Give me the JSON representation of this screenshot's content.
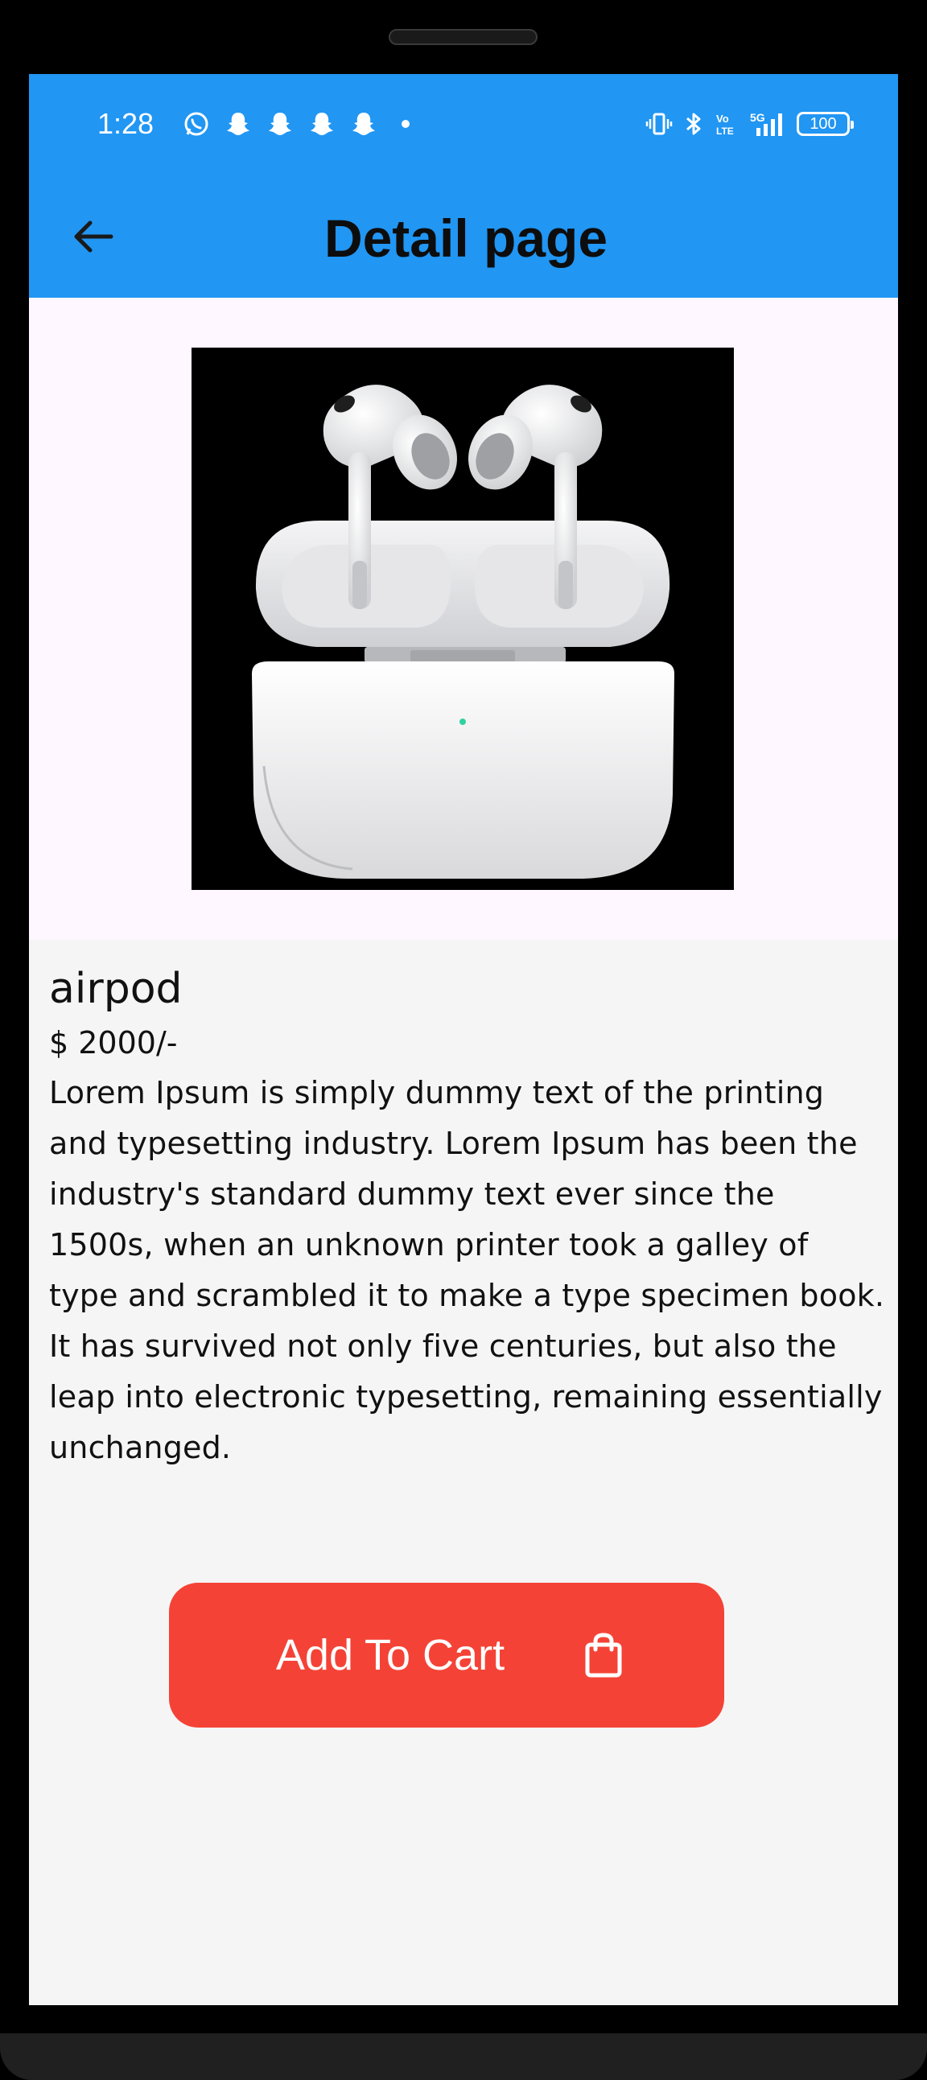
{
  "status_bar": {
    "time": "1:28",
    "battery": "100",
    "left_icons": [
      "whatsapp-icon",
      "snapchat-icon",
      "snapchat-icon",
      "snapchat-icon",
      "snapchat-icon",
      "dot-icon"
    ],
    "right_icons": [
      "vibrate-icon",
      "bluetooth-icon",
      "volte-icon",
      "5g-signal-icon",
      "battery-icon"
    ]
  },
  "app_bar": {
    "title": "Detail page",
    "back_icon": "arrow-back-icon",
    "background_color": "#2196f3"
  },
  "product": {
    "image_alt": "airpods-product-image",
    "name": "airpod",
    "price": "$ 2000/-",
    "description": "Lorem Ipsum is simply dummy text of the printing and typesetting industry. Lorem Ipsum has been the industry's standard dummy text ever since the 1500s, when an unknown printer took a galley of type and scrambled it to make a type specimen book. It has survived not only five centuries, but also the leap into electronic typesetting, remaining essentially unchanged."
  },
  "cart_button": {
    "label": "Add To Cart",
    "icon": "shopping-bag-icon",
    "color": "#f44336"
  }
}
